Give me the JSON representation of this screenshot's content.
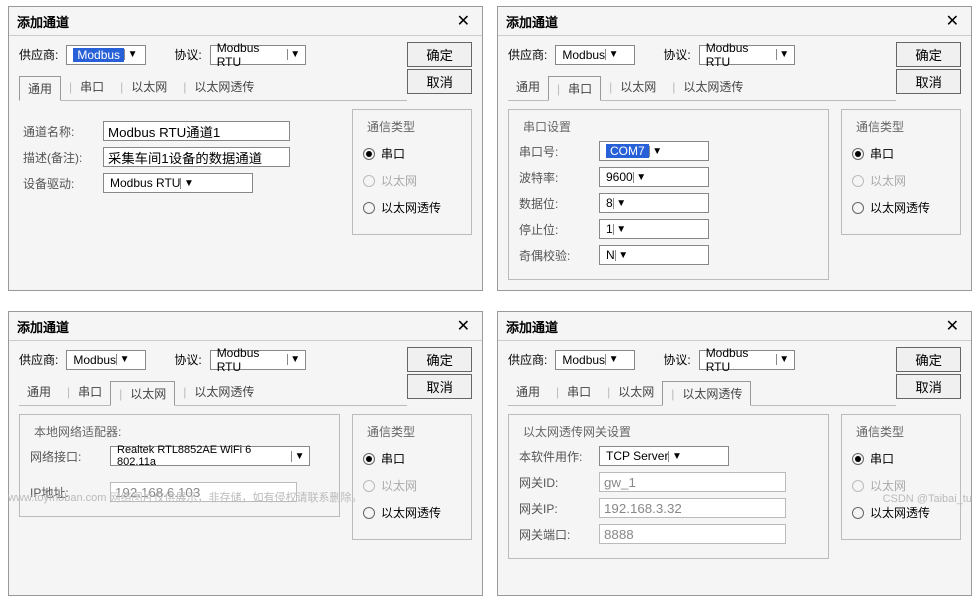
{
  "common": {
    "title": "添加通道",
    "supplier_label": "供应商:",
    "protocol_label": "协议:",
    "supplier_value": "Modbus",
    "protocol_value": "Modbus RTU",
    "ok": "确定",
    "cancel": "取消",
    "tabs": {
      "general": "通用",
      "serial": "串口",
      "ethernet": "以太网",
      "ethpass": "以太网透传"
    },
    "comm": {
      "legend": "通信类型",
      "serial": "串口",
      "ethernet": "以太网",
      "ethpass": "以太网透传"
    }
  },
  "d1": {
    "name_label": "通道名称:",
    "name_value": "Modbus RTU通道1",
    "desc_label": "描述(备注):",
    "desc_value": "采集车间1设备的数据通道",
    "driver_label": "设备驱动:",
    "driver_value": "Modbus RTU"
  },
  "d2": {
    "legend": "串口设置",
    "port_label": "串口号:",
    "port_value": "COM7",
    "baud_label": "波特率:",
    "baud_value": "9600",
    "databits_label": "数据位:",
    "databits_value": "8",
    "stopbits_label": "停止位:",
    "stopbits_value": "1",
    "parity_label": "奇偶校验:",
    "parity_value": "N"
  },
  "d3": {
    "legend": "本地网络适配器:",
    "iface_label": "网络接口:",
    "iface_value": "Realtek RTL8852AE WiFi 6 802.11a",
    "ip_label": "IP地址:",
    "ip_value": "192.168.6.103"
  },
  "d4": {
    "legend": "以太网透传网关设置",
    "role_label": "本软件用作:",
    "role_value": "TCP Server",
    "gwid_label": "网关ID:",
    "gwid_value": "gw_1",
    "gwip_label": "网关IP:",
    "gwip_value": "192.168.3.32",
    "gwport_label": "网关端口:",
    "gwport_value": "8888"
  },
  "footer": {
    "left": "www.toymoban.com 网络图片仅供展示，非存储，如有侵权请联系删除。",
    "right": "CSDN @Taibai_tu"
  }
}
